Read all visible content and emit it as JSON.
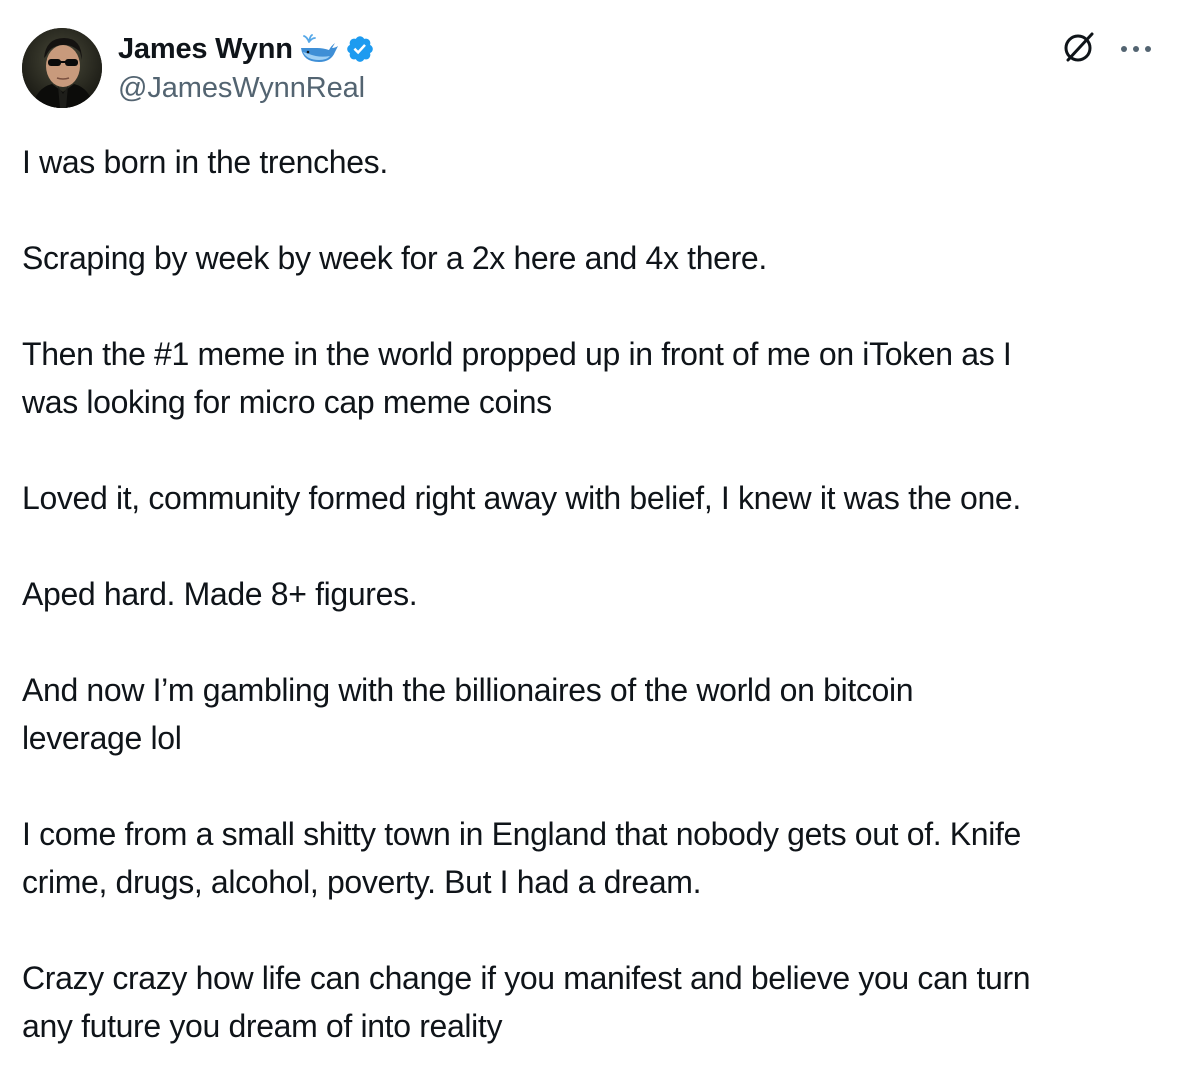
{
  "author": {
    "display_name": "James Wynn",
    "handle": "@JamesWynnReal",
    "name_emoji_icon": "whale-icon",
    "verified_icon": "verified-badge-icon",
    "accent_color": "#1d9bf0"
  },
  "actions": {
    "grok_icon": "grok-icon",
    "more_icon": "more-icon"
  },
  "tweet": {
    "paragraphs": [
      "I was born in the trenches.",
      "Scraping by week by week for a 2x here and 4x there.",
      "Then the #1 meme in the world propped up in front of me on iToken as I\nwas looking for micro cap meme coins",
      "Loved it, community formed right away with belief, I knew it was the one.",
      "Aped hard. Made 8+ figures.",
      "And now I’m gambling with the billionaires of the world on bitcoin\nleverage lol",
      "I come from a small shitty town in England that nobody gets out of. Knife\ncrime, drugs, alcohol, poverty. But I had a dream.",
      "Crazy crazy how life can change if you manifest and believe you can turn\nany future you dream of into reality"
    ]
  }
}
